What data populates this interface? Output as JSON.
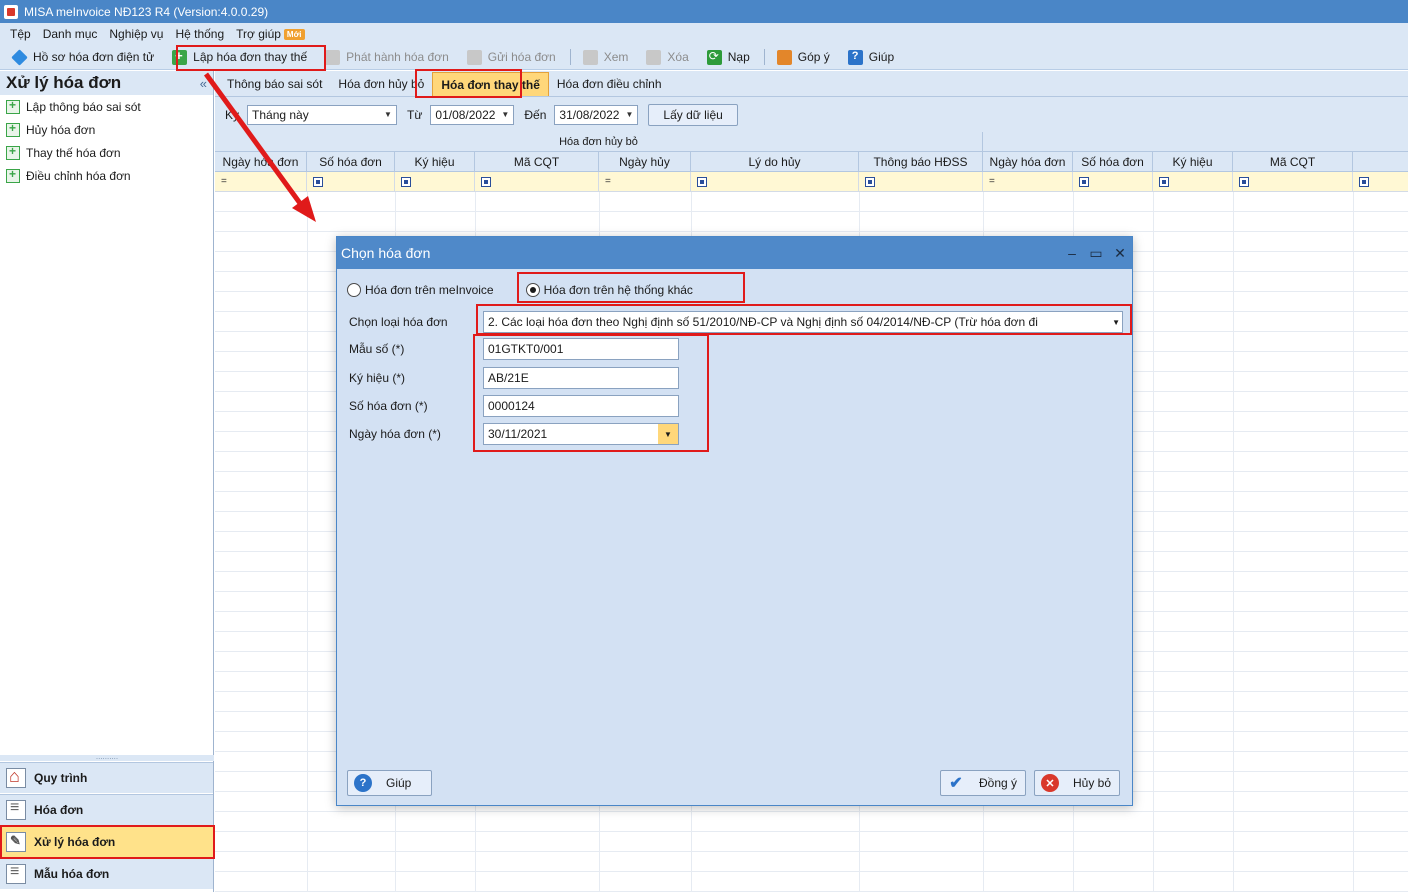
{
  "title": "MISA meInvoice NĐ123 R4 (Version:4.0.0.29)",
  "menu": [
    "Tệp",
    "Danh mục",
    "Nghiệp vụ",
    "Hệ thống",
    "Trợ giúp"
  ],
  "menu_badge": "Mới",
  "toolbar": {
    "ho_so": "Hồ sơ hóa đơn điện tử",
    "lap_thay_the": "Lập hóa đơn thay thế",
    "phat_hanh": "Phát hành hóa đơn",
    "gui": "Gửi hóa đơn",
    "xem": "Xem",
    "xoa": "Xóa",
    "nap": "Nạp",
    "gop_y": "Góp ý",
    "giup": "Giúp"
  },
  "left": {
    "title": "Xử lý hóa đơn",
    "collapse": "«",
    "items": [
      "Lập thông báo sai sót",
      "Hủy hóa đơn",
      "Thay thế hóa đơn",
      "Điều chỉnh hóa đơn"
    ],
    "splitter": "..........",
    "nav": [
      "Quy trình",
      "Hóa đơn",
      "Xử lý hóa đơn",
      "Mẫu hóa đơn"
    ]
  },
  "tabs": [
    "Thông báo sai sót",
    "Hóa đơn hủy bỏ",
    "Hóa đơn thay thế",
    "Hóa đơn điều chỉnh"
  ],
  "filter": {
    "ky_label": "Kỳ",
    "ky_value": "Tháng này",
    "tu_label": "Từ",
    "tu_value": "01/08/2022",
    "den_label": "Đến",
    "den_value": "31/08/2022",
    "button": "Lấy dữ liệu"
  },
  "grid": {
    "group": "Hóa đơn hủy bỏ",
    "columns": [
      "Ngày hóa đơn",
      "Số hóa đơn",
      "Ký hiệu",
      "Mã CQT",
      "Ngày hủy",
      "Lý do hủy",
      "Thông báo HĐSS",
      "Ngày hóa đơn",
      "Số hóa đơn",
      "Ký hiệu",
      "Mã CQT"
    ],
    "filter_eq": "="
  },
  "dialog": {
    "title": "Chọn hóa đơn",
    "radio1": "Hóa đơn trên meInvoice",
    "radio2": "Hóa đơn trên hệ thống khác",
    "loai_label": "Chọn loại hóa đơn",
    "loai_value": "2. Các loại hóa đơn theo Nghị định số 51/2010/NĐ-CP và Nghị định số 04/2014/NĐ-CP (Trừ hóa đơn đi",
    "mau_so_label": "Mẫu số (*)",
    "mau_so_value": "01GTKT0/001",
    "ky_hieu_label": "Ký hiệu (*)",
    "ky_hieu_value": "AB/21E",
    "so_hd_label": "Số hóa đơn (*)",
    "so_hd_value": "0000124",
    "ngay_hd_label": "Ngày hóa đơn (*)",
    "ngay_hd_value": "30/11/2021",
    "btn_help": "Giúp",
    "btn_ok": "Đồng ý",
    "btn_cancel": "Hủy bỏ"
  },
  "colors": {
    "titlebar": "#4a86c7",
    "panel": "#dbe7f5",
    "highlight": "#e01a1a",
    "active_tab": "#ffd77a"
  }
}
